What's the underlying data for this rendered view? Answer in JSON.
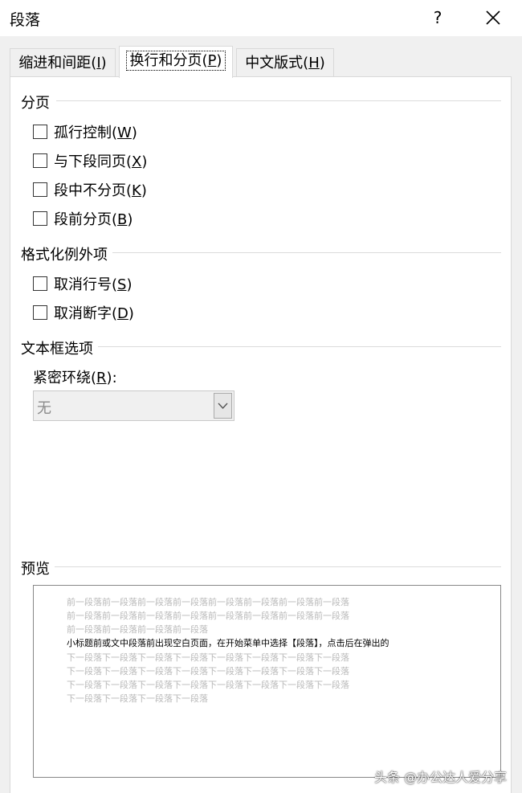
{
  "dialog": {
    "title": "段落",
    "help_label": "?"
  },
  "tabs": [
    {
      "label_prefix": "缩进和间距(",
      "mnemonic": "I",
      "label_suffix": ")"
    },
    {
      "label_prefix": "换行和分页(",
      "mnemonic": "P",
      "label_suffix": ")"
    },
    {
      "label_prefix": "中文版式(",
      "mnemonic": "H",
      "label_suffix": ")"
    }
  ],
  "pagination": {
    "heading": "分页",
    "options": [
      {
        "prefix": "孤行控制(",
        "mnemonic": "W",
        "suffix": ")",
        "checked": false
      },
      {
        "prefix": "与下段同页(",
        "mnemonic": "X",
        "suffix": ")",
        "checked": false
      },
      {
        "prefix": "段中不分页(",
        "mnemonic": "K",
        "suffix": ")",
        "checked": false
      },
      {
        "prefix": "段前分页(",
        "mnemonic": "B",
        "suffix": ")",
        "checked": false
      }
    ]
  },
  "formatting_exceptions": {
    "heading": "格式化例外项",
    "options": [
      {
        "prefix": "取消行号(",
        "mnemonic": "S",
        "suffix": ")",
        "checked": false
      },
      {
        "prefix": "取消断字(",
        "mnemonic": "D",
        "suffix": ")",
        "checked": false
      }
    ]
  },
  "textbox_options": {
    "heading": "文本框选项",
    "tight_wrap_prefix": "紧密环绕(",
    "tight_wrap_mnemonic": "R",
    "tight_wrap_suffix": "):",
    "tight_wrap_value": "无"
  },
  "preview": {
    "heading": "预览",
    "before_lines": [
      "前一段落前一段落前一段落前一段落前一段落前一段落前一段落前一段落",
      "前一段落前一段落前一段落前一段落前一段落前一段落前一段落前一段落",
      "前一段落前一段落前一段落前一段落"
    ],
    "sample_line": "小标题前或文中段落前出现空白页面，在开始菜单中选择【段落】，点击后在弹出的",
    "after_lines": [
      "下一段落下一段落下一段落下一段落下一段落下一段落下一段落下一段落",
      "下一段落下一段落下一段落下一段落下一段落下一段落下一段落下一段落",
      "下一段落下一段落下一段落下一段落下一段落下一段落下一段落下一段落",
      "下一段落下一段落下一段落下一段落"
    ]
  },
  "watermark": "头条 @办公达人爱分享",
  "icons": {
    "close": "close-icon",
    "dropdown": "chevron-down-icon"
  }
}
